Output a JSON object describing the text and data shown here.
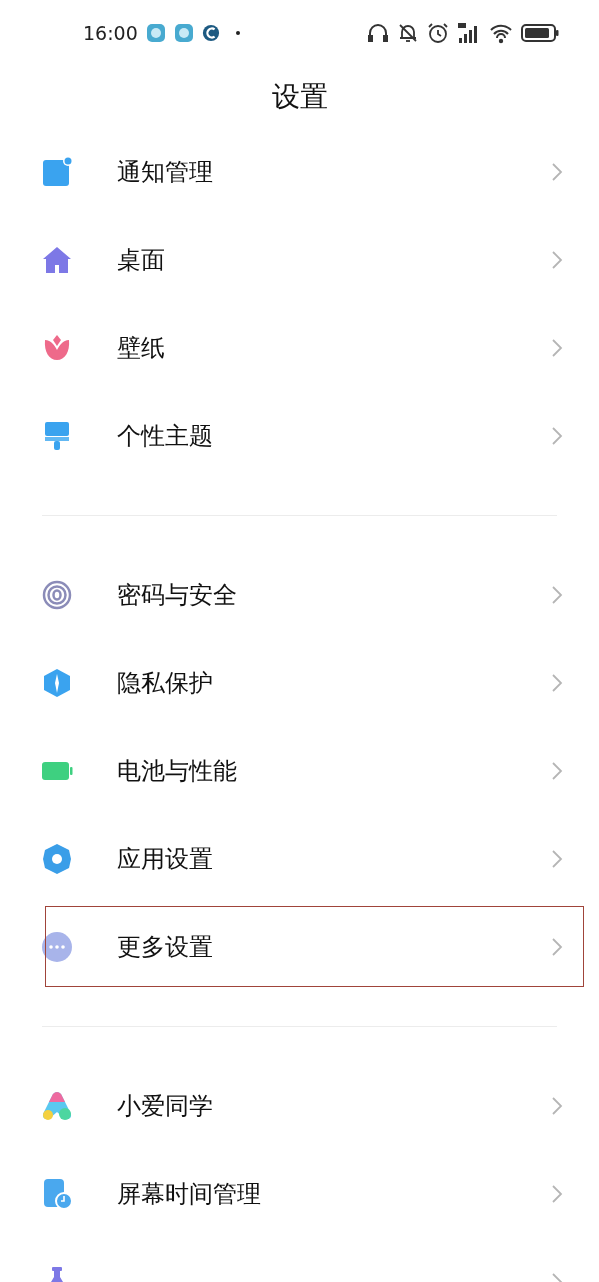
{
  "status_bar": {
    "time": "16:00"
  },
  "title": "设置",
  "groups": [
    {
      "items": [
        {
          "label": "通知管理",
          "highlighted": false
        },
        {
          "label": "桌面",
          "highlighted": false
        },
        {
          "label": "壁纸",
          "highlighted": false
        },
        {
          "label": "个性主题",
          "highlighted": false
        }
      ]
    },
    {
      "items": [
        {
          "label": "密码与安全",
          "highlighted": false
        },
        {
          "label": "隐私保护",
          "highlighted": false
        },
        {
          "label": "电池与性能",
          "highlighted": false
        },
        {
          "label": "应用设置",
          "highlighted": false
        },
        {
          "label": "更多设置",
          "highlighted": true
        }
      ]
    },
    {
      "items": [
        {
          "label": "小爱同学",
          "highlighted": false
        },
        {
          "label": "屏幕时间管理",
          "highlighted": false
        },
        {
          "highlighted": false
        }
      ]
    }
  ]
}
